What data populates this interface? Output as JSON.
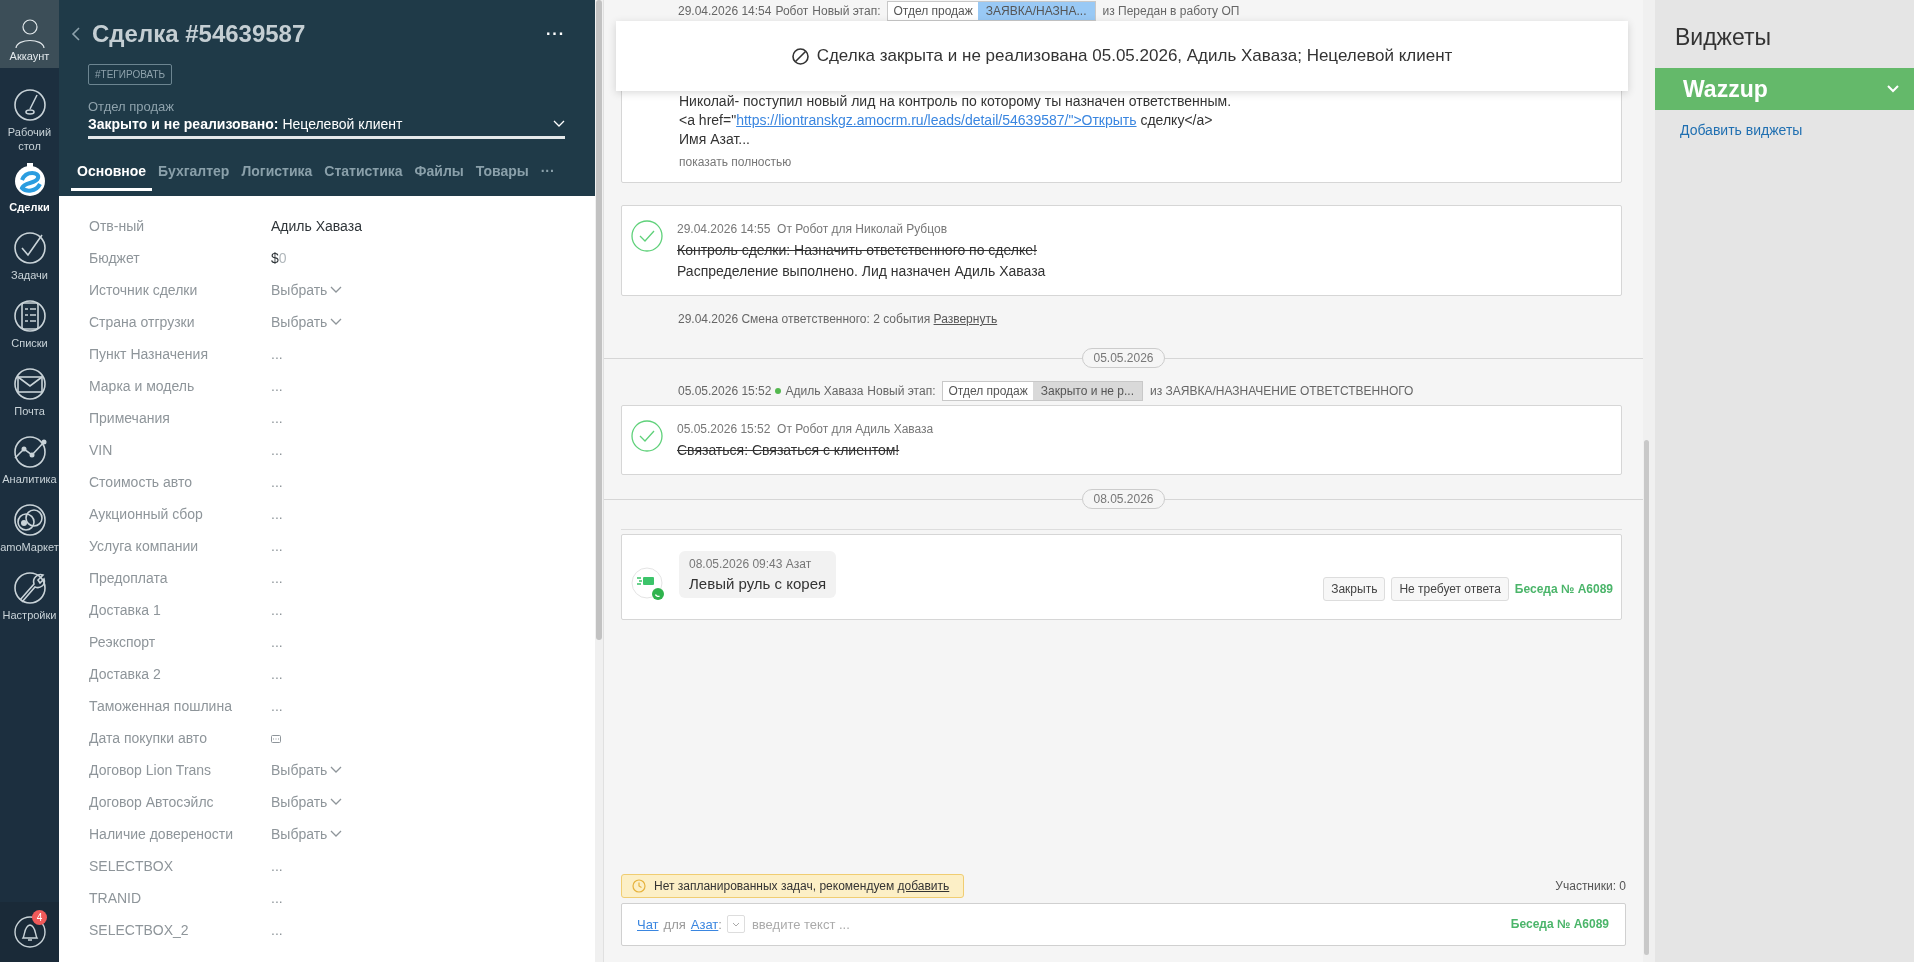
{
  "nav": {
    "account": "Аккаунт",
    "items": [
      {
        "label": "Рабочий стол",
        "selected": false
      },
      {
        "label": "Сделки",
        "selected": true
      },
      {
        "label": "Задачи",
        "selected": false
      },
      {
        "label": "Списки",
        "selected": false
      },
      {
        "label": "Почта",
        "selected": false
      },
      {
        "label": "Аналитика",
        "selected": false
      },
      {
        "label": "amoМаркет",
        "selected": false
      },
      {
        "label": "Настройки",
        "selected": false
      }
    ],
    "notifications_badge": "4"
  },
  "lead": {
    "title": "Сделка #54639587",
    "menu": "···",
    "tag_button": "#ТЕГИРОВАТЬ",
    "pipeline": "Отдел продаж",
    "status": "Закрыто и не реализовано:",
    "status_reason": "Нецелевой клиент",
    "tabs": [
      {
        "label": "Основное",
        "selected": true
      },
      {
        "label": "Бухгалтер",
        "selected": false
      },
      {
        "label": "Логистика",
        "selected": false
      },
      {
        "label": "Статистика",
        "selected": false
      },
      {
        "label": "Файлы",
        "selected": false
      },
      {
        "label": "Товары",
        "selected": false
      }
    ],
    "tabs_more": "···",
    "fields": [
      {
        "label": "Отв-ный",
        "kind": "text",
        "value": "Адиль Хаваза"
      },
      {
        "label": "Бюджет",
        "kind": "money",
        "currency": "$",
        "value": "0"
      },
      {
        "label": "Источник сделки",
        "kind": "select",
        "placeholder": "Выбрать"
      },
      {
        "label": "Страна отгрузки",
        "kind": "select",
        "placeholder": "Выбрать"
      },
      {
        "label": "Пункт Назначения",
        "kind": "empty",
        "placeholder": "..."
      },
      {
        "label": "Марка и модель",
        "kind": "empty",
        "placeholder": "..."
      },
      {
        "label": "Примечания",
        "kind": "empty",
        "placeholder": "..."
      },
      {
        "label": "VIN",
        "kind": "empty",
        "placeholder": "..."
      },
      {
        "label": "Стоимость авто",
        "kind": "empty",
        "placeholder": "..."
      },
      {
        "label": "Аукционный сбор",
        "kind": "empty",
        "placeholder": "..."
      },
      {
        "label": "Услуга компании",
        "kind": "empty",
        "placeholder": "..."
      },
      {
        "label": "Предоплата",
        "kind": "empty",
        "placeholder": "..."
      },
      {
        "label": "Доставка 1",
        "kind": "empty",
        "placeholder": "..."
      },
      {
        "label": "Реэкспорт",
        "kind": "empty",
        "placeholder": "..."
      },
      {
        "label": "Доставка 2",
        "kind": "empty",
        "placeholder": "..."
      },
      {
        "label": "Таможенная пошлина",
        "kind": "empty",
        "placeholder": "..."
      },
      {
        "label": "Дата покупки авто",
        "kind": "date"
      },
      {
        "label": "Договор Lion Trans",
        "kind": "select",
        "placeholder": "Выбрать"
      },
      {
        "label": "Договор Автосэйлс",
        "kind": "select",
        "placeholder": "Выбрать"
      },
      {
        "label": "Наличие доверености",
        "kind": "select",
        "placeholder": "Выбрать"
      },
      {
        "label": "SELECTBOX",
        "kind": "empty",
        "placeholder": "..."
      },
      {
        "label": "TRANID",
        "kind": "empty",
        "placeholder": "..."
      },
      {
        "label": "SELECTBOX_2",
        "kind": "empty",
        "placeholder": "..."
      }
    ]
  },
  "feed": {
    "banner": "Сделка закрыта и не реализована 05.05.2026, Адиль Хаваза; Нецелевой клиент",
    "events": [
      {
        "kind": "stage",
        "time": "29.04.2026 14:54",
        "online": false,
        "author": "Робот",
        "label": "Новый этап:",
        "pipeline": "Отдел продаж",
        "status": "ЗАЯВКА/НАЗНА...",
        "color": "#99c9f5",
        "from": "из Передан в работу ОП"
      },
      {
        "kind": "note",
        "lines": [
          "Николай- поступил новый лид на контроль по которому ты назначен ответственным."
        ],
        "link_before": "<a href=\"",
        "link": "https://liontranskgz.amocrm.ru/leads/detail/54639587/\">Открыть",
        "link_after": " сделку</a>",
        "tail": "Имя Азат...",
        "more": "показать полностью"
      },
      {
        "kind": "task",
        "done": true,
        "time": "29.04.2026 14:55",
        "meta": "От Робот для Николай Рубцов",
        "task": "Контроль сделки: Назначить ответственного по сделке!",
        "result": "Распределение выполнено. Лид назначен Адиль Хаваза"
      },
      {
        "kind": "summary",
        "text": "29.04.2026 Смена ответственного: 2 события",
        "link": "Развернуть"
      },
      {
        "kind": "date",
        "label": "05.05.2026"
      },
      {
        "kind": "stage",
        "time": "05.05.2026 15:52",
        "online": true,
        "author": "Адиль Хаваза",
        "label": "Новый этап:",
        "pipeline": "Отдел продаж",
        "status": "Закрыто и не р...",
        "color": "#d9d9d9",
        "from": "из ЗАЯВКА/НАЗНАЧЕНИЕ ОТВЕТСТВЕННОГО"
      },
      {
        "kind": "task",
        "done": true,
        "time": "05.05.2026 15:52",
        "meta": "От Робот для Адиль Хаваза",
        "task": "Связаться: Связаться с клиентом!"
      },
      {
        "kind": "date",
        "label": "08.05.2026"
      },
      {
        "kind": "chat",
        "meta": "08.05.2026 09:43 Азат",
        "text": "Левый руль с корея",
        "buttons": [
          "Закрыть",
          "Не требует ответа"
        ],
        "conversation": "Беседа № A6089"
      }
    ],
    "notice": {
      "text": "Нет запланированных задач, рекомендуем ",
      "link": "добавить"
    },
    "participants": "Участники: 0",
    "composer": {
      "mode": "Чат",
      "for": "для",
      "recipient": "Азат",
      "separator": ":",
      "placeholder": "введите текст ...",
      "conversation": "Беседа № A6089"
    }
  },
  "widgets": {
    "title": "Виджеты",
    "items": [
      {
        "name": "Wazzup"
      }
    ],
    "add_link": "Добавить виджеты"
  }
}
